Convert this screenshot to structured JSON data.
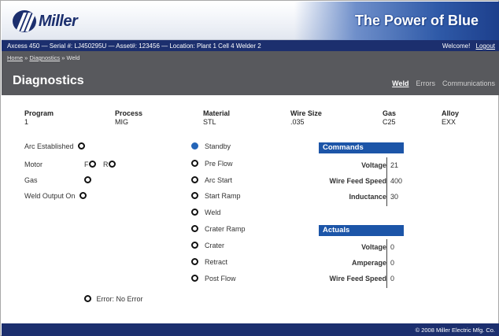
{
  "header": {
    "logo_text": "Miller",
    "tagline": "The Power of Blue"
  },
  "statusbar": {
    "machine_info": "Axcess 450 — Serial #: LJ450295U — Asset#: 123456 — Location: Plant 1 Cell 4 Welder 2",
    "welcome": "Welcome!",
    "logout": "Logout"
  },
  "breadcrumb": {
    "home": "Home",
    "diagnostics": "Diagnostics",
    "current": "Weld"
  },
  "page": {
    "title": "Diagnostics"
  },
  "tabs": [
    {
      "label": "Weld",
      "active": true
    },
    {
      "label": "Errors",
      "active": false
    },
    {
      "label": "Communications",
      "active": false
    }
  ],
  "info": [
    {
      "label": "Program",
      "value": "1"
    },
    {
      "label": "Process",
      "value": "MIG"
    },
    {
      "label": "Material",
      "value": "STL"
    },
    {
      "label": "Wire Size",
      "value": ".035"
    },
    {
      "label": "Gas",
      "value": "C25"
    },
    {
      "label": "Alloy",
      "value": "EXX"
    }
  ],
  "indicators": {
    "arc_established": "Arc Established",
    "motor": "Motor",
    "motor_forward": "F",
    "motor_reverse": "R",
    "gas": "Gas",
    "weld_output_on": "Weld Output On",
    "error_label": "Error:",
    "error_value": "No Error"
  },
  "weld_states": [
    {
      "label": "Standby",
      "active": true
    },
    {
      "label": "Pre Flow",
      "active": false
    },
    {
      "label": "Arc Start",
      "active": false
    },
    {
      "label": "Start Ramp",
      "active": false
    },
    {
      "label": "Weld",
      "active": false
    },
    {
      "label": "Crater Ramp",
      "active": false
    },
    {
      "label": "Crater",
      "active": false
    },
    {
      "label": "Retract",
      "active": false
    },
    {
      "label": "Post Flow",
      "active": false
    }
  ],
  "commands": {
    "title": "Commands",
    "rows": [
      {
        "label": "Voltage",
        "value": "21"
      },
      {
        "label": "Wire Feed Speed",
        "value": "400"
      },
      {
        "label": "Inductance",
        "value": "30"
      }
    ]
  },
  "actuals": {
    "title": "Actuals",
    "rows": [
      {
        "label": "Voltage",
        "value": "0"
      },
      {
        "label": "Amperage",
        "value": "0"
      },
      {
        "label": "Wire Feed Speed",
        "value": "0"
      }
    ]
  },
  "footer": {
    "copyright": "© 2008 Miller Electric Mfg. Co."
  },
  "colors": {
    "navy": "#1c2f6e",
    "panel_blue": "#1c55a8",
    "active_indicator": "#2565b8",
    "title_strip": "#58595d"
  }
}
